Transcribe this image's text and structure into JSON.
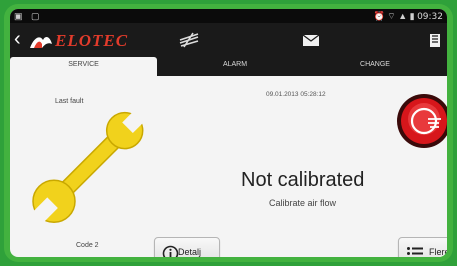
{
  "statusbar": {
    "time": "09:32",
    "left_icons": [
      "image-icon",
      "sd-card-icon"
    ],
    "right_icons": [
      "alarm-clock-icon",
      "wifi-icon",
      "signal-icon",
      "battery-icon"
    ]
  },
  "appbar": {
    "brand": "ELOTEC",
    "brand_color": "#e23b2b"
  },
  "tabs": [
    {
      "label": "SERVICE",
      "icon": "fan-icon",
      "selected": true
    },
    {
      "label": "ALARM",
      "icon": "envelope-icon",
      "selected": false
    },
    {
      "label": "CHANGE",
      "icon": "filter-icon",
      "selected": false
    }
  ],
  "main": {
    "last_fault_label": "Last fault",
    "datetime": "09.01.2013 05:28:12",
    "code": "Code 2",
    "status_title": "Not calibrated",
    "status_subtitle": "Calibrate air flow"
  },
  "buttons": {
    "detail": "Detalj",
    "more": "Flere"
  },
  "colors": {
    "frame": "#43b23f",
    "wrench": "#f1d21c",
    "alarm": "#d7161b"
  }
}
